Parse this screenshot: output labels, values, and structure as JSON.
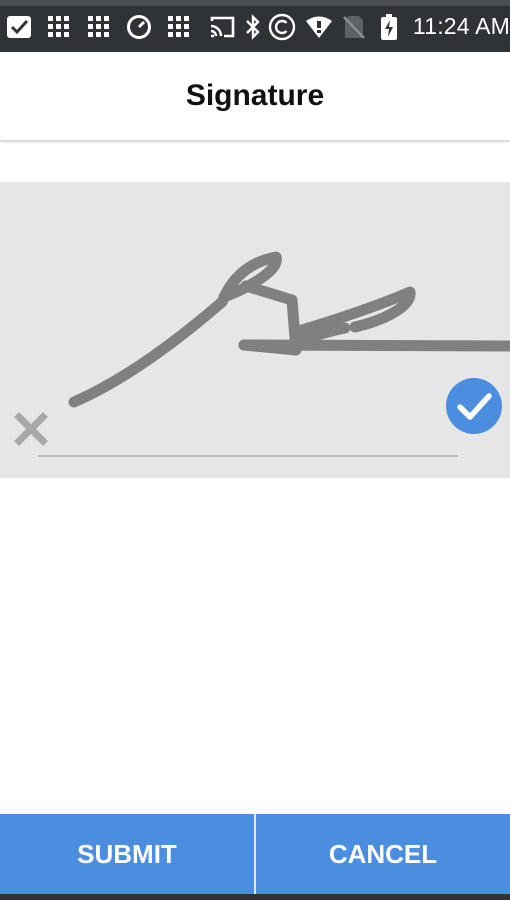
{
  "status_bar": {
    "time": "11:24 AM",
    "icons": [
      "checkbox-icon",
      "grid-icon",
      "grid-icon",
      "clock-icon",
      "grid-icon",
      "cast-icon",
      "bluetooth-icon",
      "copyright-icon",
      "wifi-icon",
      "no-sim-icon",
      "battery-charging-icon"
    ]
  },
  "header": {
    "title": "Signature"
  },
  "signature_pad": {
    "has_signature": true,
    "clear_icon": "close-icon",
    "confirm_icon": "check-circle-icon"
  },
  "actions": {
    "submit_label": "SUBMIT",
    "cancel_label": "CANCEL"
  },
  "colors": {
    "accent": "#4b8edf",
    "pad_background": "#e6e6e6",
    "stroke": "#808080",
    "status_bar": "#2f3237"
  }
}
